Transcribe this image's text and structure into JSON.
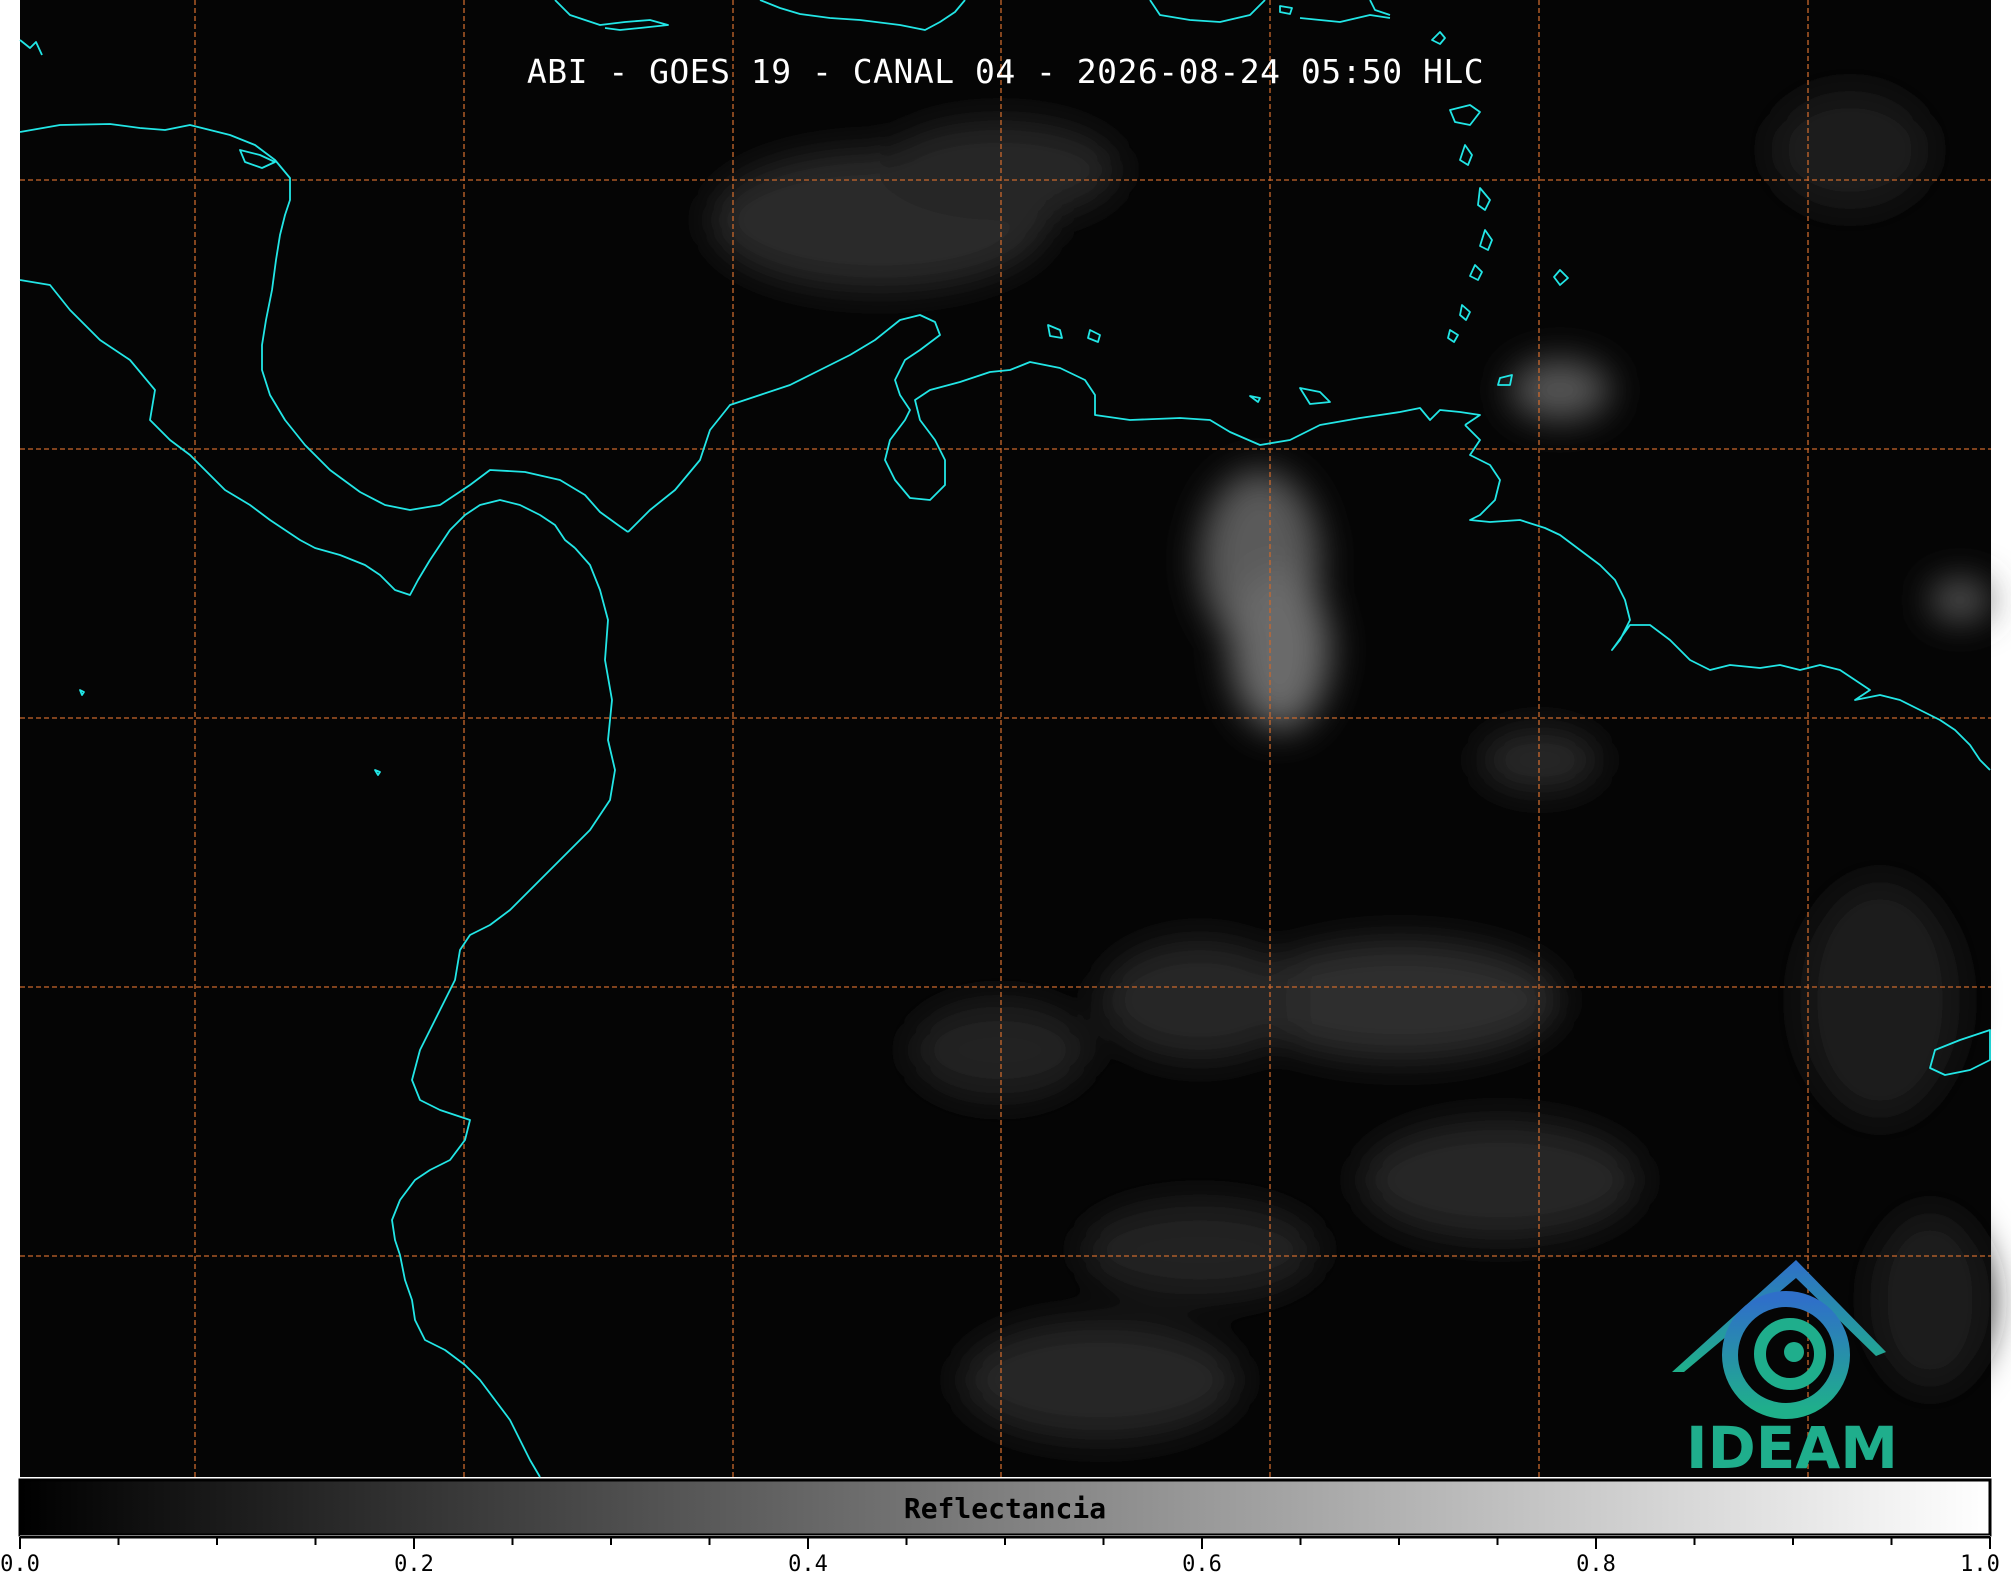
{
  "title": "ABI - GOES 19 - CANAL 04 - 2026-08-24 05:50 HLC",
  "colorbar": {
    "label": "Reflectancia",
    "min": 0.0,
    "max": 1.0,
    "major_ticks": [
      "0.0",
      "0.2",
      "0.4",
      "0.6",
      "0.8",
      "1.0"
    ],
    "minor_step": 0.05
  },
  "logo": {
    "text": "IDEAM"
  },
  "colors": {
    "background": "#000000",
    "coastline": "#22e6e6",
    "gridline": "#c9682c",
    "cloud": "#8c8c8c",
    "logo_blue": "#2f7fc9",
    "logo_green": "#1fae8c"
  }
}
